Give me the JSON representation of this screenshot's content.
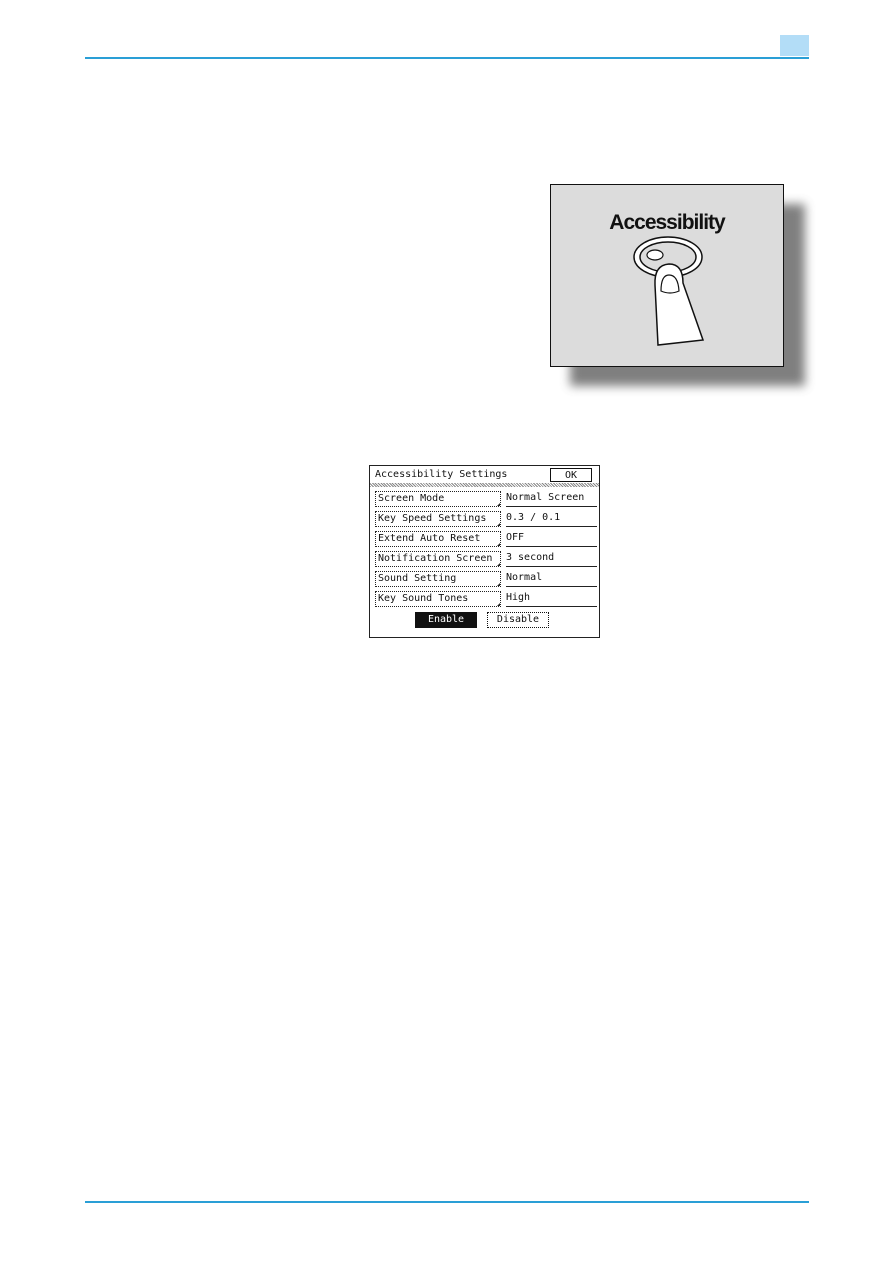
{
  "page": {
    "accent_color": "#2a9fd6",
    "tab_color": "#b3ddf7"
  },
  "illustration": {
    "label": "Accessibility",
    "icon": "finger-pressing-button-icon"
  },
  "panel": {
    "title": "Accessibility Settings",
    "ok_label": "OK",
    "rows": [
      {
        "label": "Screen Mode",
        "value": "Normal Screen"
      },
      {
        "label": "Key Speed Settings",
        "value": "0.3 / 0.1"
      },
      {
        "label": "Extend Auto Reset",
        "value": "OFF"
      },
      {
        "label": "Notification Screen",
        "value": "3 second"
      },
      {
        "label": "Sound Setting",
        "value": "Normal"
      },
      {
        "label": "Key Sound Tones",
        "value": "High"
      }
    ],
    "enable_label": "Enable",
    "disable_label": "Disable",
    "selected": "Enable"
  }
}
